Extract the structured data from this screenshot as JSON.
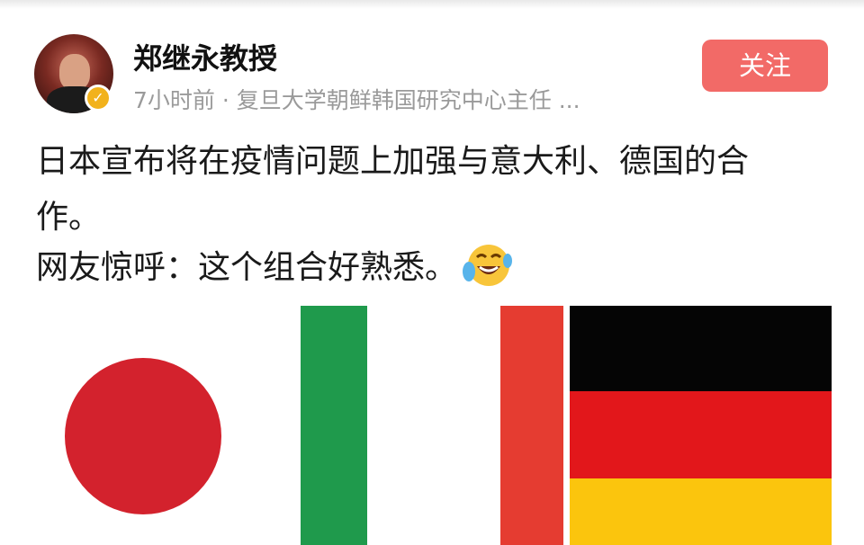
{
  "author": {
    "name": "郑继永教授",
    "verified_icon": "verified-badge-icon"
  },
  "meta": {
    "text": "7小时前 · 复旦大学朝鲜韩国研究中心主任 ..."
  },
  "actions": {
    "follow_label": "关注"
  },
  "post": {
    "line1": "日本宣布将在疫情问题上加强与意大利、德国的合",
    "line2": "作。",
    "line3": "网友惊呼：这个组合好熟悉。",
    "emoji_icon": "laughing-tears-emoji-icon"
  },
  "image": {
    "flags": [
      "japan-flag",
      "italy-flag",
      "germany-flag"
    ]
  },
  "colors": {
    "follow_button": "#f26a67",
    "japan_red": "#d3222d",
    "italy_green": "#1f9a4c",
    "italy_red": "#e53c31",
    "germany_black": "#050505",
    "germany_red": "#e2171b",
    "germany_gold": "#fbc50d"
  }
}
